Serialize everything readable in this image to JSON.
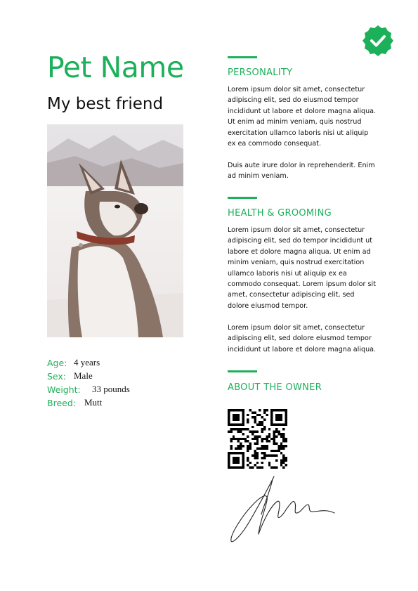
{
  "header": {
    "title": "Pet Name",
    "subtitle": "My best friend"
  },
  "badge": {
    "icon": "verified-check-icon",
    "color": "#1db05a"
  },
  "photo": {
    "description": "dog-photo"
  },
  "facts": [
    {
      "label": "Age:",
      "value": "4 years"
    },
    {
      "label": "Sex:",
      "value": "Male"
    },
    {
      "label": "Weight:",
      "value": "33 pounds"
    },
    {
      "label": "Breed:",
      "value": "Mutt"
    }
  ],
  "sections": {
    "personality": {
      "heading": "PERSONALITY",
      "p1": "Lorem ipsum dolor sit amet, consectetur adipiscing elit, sed do eiusmod tempor incididunt ut labore et dolore magna aliqua. Ut enim ad minim veniam, quis nostrud exercitation ullamco laboris nisi ut aliquip ex ea commodo consequat.",
      "p2": "Duis aute irure dolor in reprehenderit. Enim ad minim veniam."
    },
    "health": {
      "heading": "HEALTH & GROOMING",
      "p1": "Lorem ipsum dolor sit amet, consectetur adipiscing elit, sed do tempor incididunt ut labore et dolore magna aliqua. Ut enim ad minim veniam, quis nostrud exercitation ullamco laboris nisi ut aliquip ex ea commodo consequat. Lorem ipsum dolor sit amet, consectetur adipiscing elit, sed dolore eiusmod tempor.",
      "p2": "Lorem ipsum dolor sit amet, consectetur adipiscing elit, sed dolore eiusmod tempor incididunt ut labore et dolore magna aliqua."
    },
    "owner": {
      "heading": "ABOUT THE OWNER",
      "qr_icon": "qr-code-icon",
      "signature_icon": "signature-icon"
    }
  },
  "colors": {
    "accent": "#1db05a",
    "text": "#111111"
  }
}
